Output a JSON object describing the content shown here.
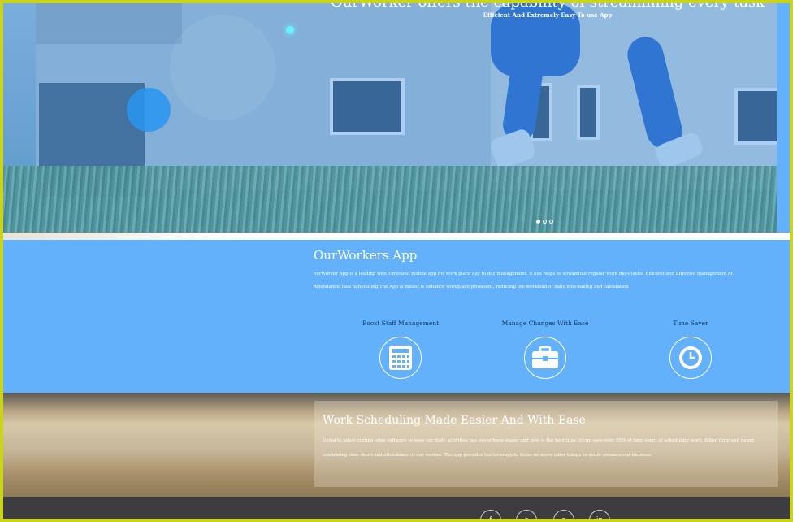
{
  "hero": {
    "title": "OurWorker offers the capability of streamlining every task",
    "subtitle": "Efficient And Extremely Easy To use App",
    "slides": [
      {
        "active": true
      },
      {
        "active": false
      },
      {
        "active": false
      }
    ]
  },
  "about": {
    "title": "OurWorkers App",
    "text": "ourWorker App is a leading web Timesand mobile app for work place day to day management. it has helps to streamline regular work days tasks. Efficient and Effective management of Attendance,Task Scheduling.The App is meant is enhance workplace proficient, reducing the workload of daily note-taking and calculation",
    "features": [
      {
        "label": "Boost Staff Management",
        "icon": "calculator-icon"
      },
      {
        "label": "Manage Changes With Ease",
        "icon": "briefcase-icon"
      },
      {
        "label": "Time Saver",
        "icon": "clock-icon"
      }
    ]
  },
  "work": {
    "title": "Work Scheduling Made Easier And With Ease",
    "text": "Using te latest cutting edge software to ease our daily activities has never been easier and now is the best time, it can save over 85% of time spent of scheduling work, filling form and paper, confirming time-sheet and attendance of our worker. The app provides the leverage to focus on more other things to could enhance our business"
  },
  "footer": {
    "social": [
      {
        "icon": "facebook-icon"
      },
      {
        "icon": "twitter-icon"
      },
      {
        "icon": "google-plus-icon"
      },
      {
        "icon": "linkedin-icon"
      }
    ]
  },
  "colors": {
    "accent": "#64b1fb",
    "frame": "#c8d617",
    "footer": "#3d3c3f"
  }
}
